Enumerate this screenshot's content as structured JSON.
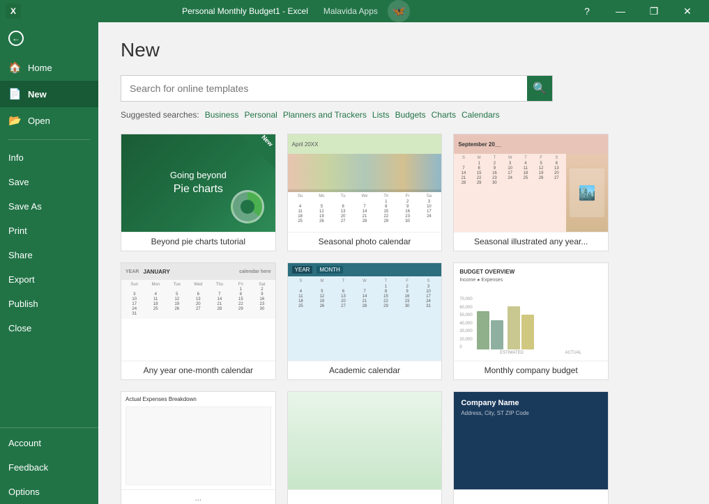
{
  "titlebar": {
    "title": "Personal Monthly Budget1  -  Excel",
    "app_name": "Malavida Apps",
    "minimize_label": "—",
    "maximize_label": "❐",
    "close_label": "✕",
    "help_label": "?"
  },
  "sidebar": {
    "back_label": "←",
    "items": [
      {
        "id": "home",
        "label": "Home",
        "icon": "🏠"
      },
      {
        "id": "new",
        "label": "New",
        "icon": "📄",
        "active": true
      },
      {
        "id": "open",
        "label": "Open",
        "icon": "📂"
      }
    ],
    "menu_items": [
      {
        "id": "info",
        "label": "Info"
      },
      {
        "id": "save",
        "label": "Save"
      },
      {
        "id": "save-as",
        "label": "Save As"
      },
      {
        "id": "print",
        "label": "Print"
      },
      {
        "id": "share",
        "label": "Share"
      },
      {
        "id": "export",
        "label": "Export"
      },
      {
        "id": "publish",
        "label": "Publish"
      },
      {
        "id": "close",
        "label": "Close"
      }
    ],
    "bottom_items": [
      {
        "id": "account",
        "label": "Account"
      },
      {
        "id": "feedback",
        "label": "Feedback"
      },
      {
        "id": "options",
        "label": "Options"
      }
    ]
  },
  "main": {
    "page_title": "New",
    "search_placeholder": "Search for online templates",
    "search_icon": "🔍",
    "suggested_label": "Suggested searches:",
    "suggested_tags": [
      "Business",
      "Personal",
      "Planners and Trackers",
      "Lists",
      "Budgets",
      "Charts",
      "Calendars"
    ],
    "templates": [
      {
        "id": "pie-charts",
        "name": "Beyond pie charts tutorial",
        "type": "pie",
        "is_new": true,
        "line1": "Going beyond",
        "line2": "Pie charts"
      },
      {
        "id": "seasonal-photo",
        "name": "Seasonal photo calendar",
        "type": "calendar-photo"
      },
      {
        "id": "seasonal-illustrated",
        "name": "Seasonal illustrated any year...",
        "type": "calendar-season"
      },
      {
        "id": "any-year",
        "name": "Any year one-month calendar",
        "type": "calendar-year"
      },
      {
        "id": "academic",
        "name": "Academic calendar",
        "type": "academic"
      },
      {
        "id": "monthly-budget",
        "name": "Monthly company budget",
        "type": "budget"
      },
      {
        "id": "expenses",
        "name": "Actual Expenses Breakdown",
        "type": "expenses"
      },
      {
        "id": "green-template",
        "name": "",
        "type": "green"
      },
      {
        "id": "company-card",
        "name": "Company Name",
        "type": "company"
      }
    ]
  }
}
